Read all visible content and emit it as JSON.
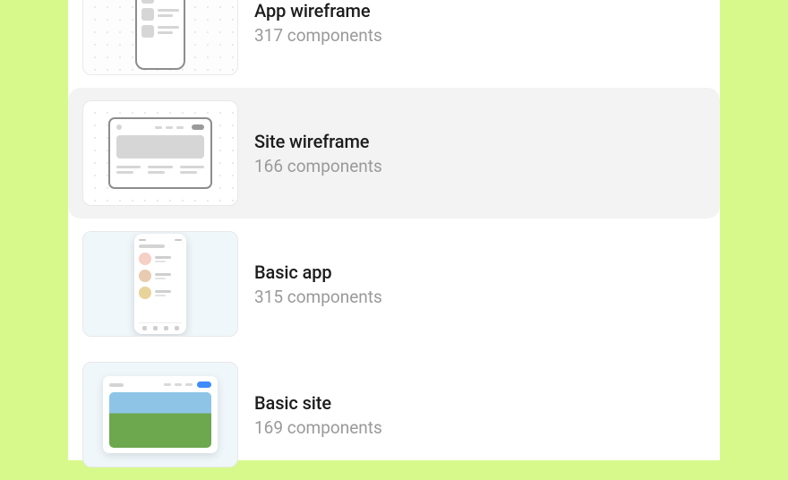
{
  "items": [
    {
      "title": "App wireframe",
      "subtitle": "317 components"
    },
    {
      "title": "Site wireframe",
      "subtitle": "166 components"
    },
    {
      "title": "Basic app",
      "subtitle": "315 components"
    },
    {
      "title": "Basic site",
      "subtitle": "169 components"
    }
  ]
}
